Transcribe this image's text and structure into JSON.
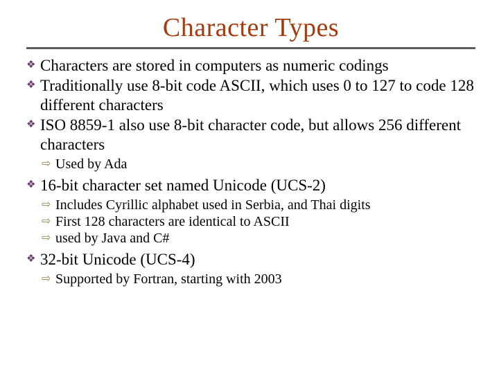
{
  "title": "Character Types",
  "bullets": {
    "b0": "Characters are stored in computers as numeric codings",
    "b1": "Traditionally use 8-bit code ASCII, which uses 0 to 127 to code 128 different characters",
    "b2": "ISO 8859-1 also use 8-bit character code, but allows 256 different characters",
    "b2_subs": {
      "s0": "Used by Ada"
    },
    "b3": "16-bit character set named Unicode (UCS-2)",
    "b3_subs": {
      "s0": "Includes Cyrillic alphabet used in Serbia, and Thai digits",
      "s1": "First 128 characters are identical to ASCII",
      "s2": "used by Java and C#"
    },
    "b4": "32-bit Unicode (UCS-4)",
    "b4_subs": {
      "s0": "Supported by Fortran, starting with 2003"
    }
  },
  "icons": {
    "diamond": "❖",
    "arrow": "⇨"
  }
}
